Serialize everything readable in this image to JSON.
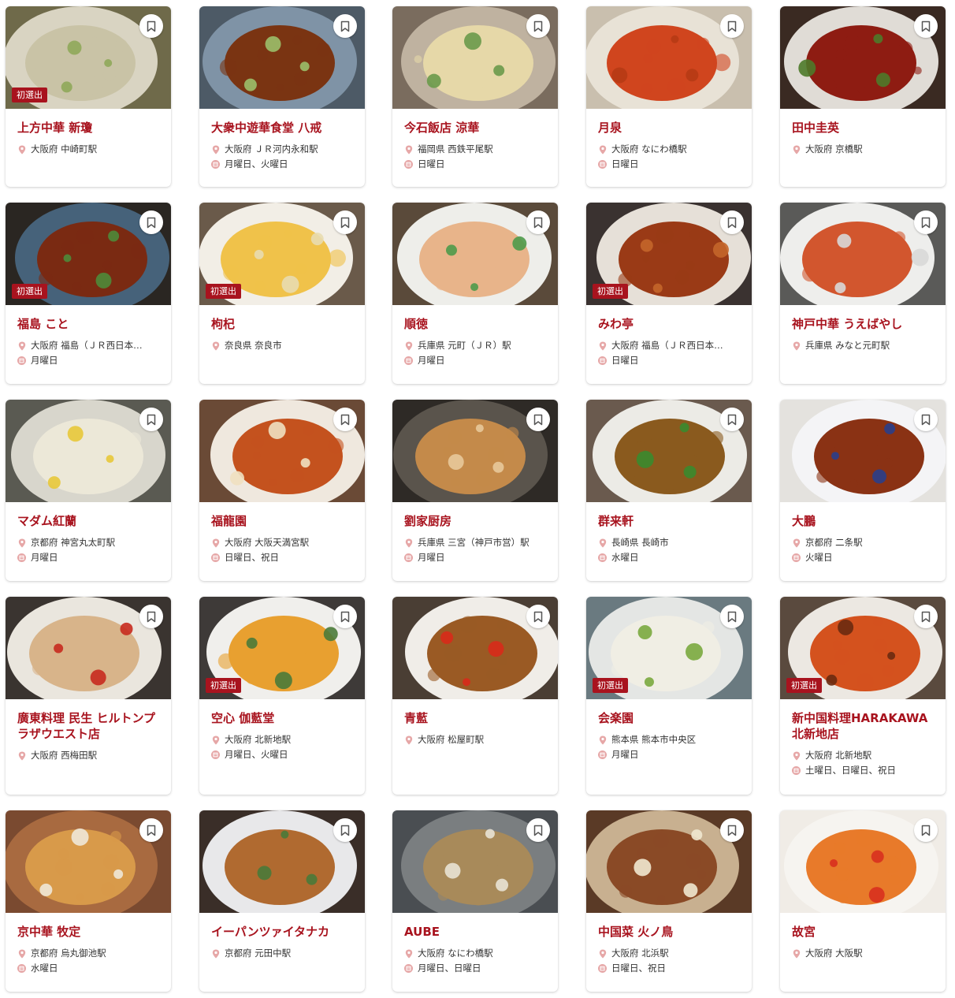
{
  "colors": {
    "accent": "#a8131e",
    "badge_bg": "#a8131e",
    "closed_icon": "#e6a7a7"
  },
  "icons": {
    "location": "map-pin-icon",
    "closed": "closed-day-icon",
    "bookmark": "bookmark-icon"
  },
  "restaurants": [
    {
      "name": "上方中華 新瓊",
      "location": "大阪府 中崎町駅",
      "closed": "",
      "badge": "初選出",
      "photo": {
        "bg": "#6f6a4a",
        "plate": "#d9d4c2",
        "food": "#c9c3a6",
        "accent": "#8fa85a"
      }
    },
    {
      "name": "大衆中遊華食堂 八戒",
      "location": "大阪府 ＪＲ河内永和駅",
      "closed": "月曜日、火曜日",
      "badge": "",
      "photo": {
        "bg": "#4d5a66",
        "plate": "#7f93a6",
        "food": "#7a3412",
        "accent": "#9bbf6a"
      }
    },
    {
      "name": "今石飯店 涼華",
      "location": "福岡県 西鉄平尾駅",
      "closed": "日曜日",
      "badge": "",
      "photo": {
        "bg": "#7a6c5e",
        "plate": "#bfb2a0",
        "food": "#e6d8a8",
        "accent": "#6a9a4a"
      }
    },
    {
      "name": "月泉",
      "location": "大阪府 なにわ橋駅",
      "closed": "日曜日",
      "badge": "",
      "photo": {
        "bg": "#c9bfae",
        "plate": "#e8e2d6",
        "food": "#d0451e",
        "accent": "#b63a14"
      }
    },
    {
      "name": "田中圭英",
      "location": "大阪府 京橋駅",
      "closed": "",
      "badge": "",
      "photo": {
        "bg": "#3a2a22",
        "plate": "#e0dcd6",
        "food": "#8e1c12",
        "accent": "#4e7a2a"
      }
    },
    {
      "name": "福島 こと",
      "location": "大阪府 福島（ＪＲ西日本…",
      "closed": "月曜日",
      "badge": "初選出",
      "photo": {
        "bg": "#2a2622",
        "plate": "#46627a",
        "food": "#7a2a12",
        "accent": "#4e8a3a"
      }
    },
    {
      "name": "枸杞",
      "location": "奈良県 奈良市",
      "closed": "",
      "badge": "初選出",
      "photo": {
        "bg": "#6a5a4a",
        "plate": "#f2eee6",
        "food": "#f0c24a",
        "accent": "#e8dcb0"
      }
    },
    {
      "name": "順徳",
      "location": "兵庫県 元町（ＪＲ）駅",
      "closed": "月曜日",
      "badge": "",
      "photo": {
        "bg": "#5a4a3a",
        "plate": "#eeeeea",
        "food": "#e8b48a",
        "accent": "#4e9a4a"
      }
    },
    {
      "name": "みわ亭",
      "location": "大阪府 福島（ＪＲ西日本…",
      "closed": "日曜日",
      "badge": "初選出",
      "photo": {
        "bg": "#3a3230",
        "plate": "#e6e0d8",
        "food": "#9a3a16",
        "accent": "#c4662a"
      }
    },
    {
      "name": "神戸中華 うえばやし",
      "location": "兵庫県 みなと元町駅",
      "closed": "",
      "badge": "",
      "photo": {
        "bg": "#5a5a58",
        "plate": "#eeeeec",
        "food": "#d2562e",
        "accent": "#d8d8d8"
      }
    },
    {
      "name": "マダム紅蘭",
      "location": "京都府 神宮丸太町駅",
      "closed": "月曜日",
      "badge": "",
      "photo": {
        "bg": "#5a5a52",
        "plate": "#d8d6cc",
        "food": "#ece8d8",
        "accent": "#e8c83a"
      }
    },
    {
      "name": "福龍園",
      "location": "大阪府 大阪天満宮駅",
      "closed": "日曜日、祝日",
      "badge": "",
      "photo": {
        "bg": "#6a4a36",
        "plate": "#efe8de",
        "food": "#c4521e",
        "accent": "#f0e0c0"
      }
    },
    {
      "name": "劉家厨房",
      "location": "兵庫県 三宮（神戸市営）駅",
      "closed": "月曜日",
      "badge": "",
      "photo": {
        "bg": "#2e2a26",
        "plate": "#5a544c",
        "food": "#c48a4a",
        "accent": "#e8c89a"
      }
    },
    {
      "name": "群来軒",
      "location": "長崎県 長崎市",
      "closed": "水曜日",
      "badge": "",
      "photo": {
        "bg": "#6a5a4e",
        "plate": "#ecebe6",
        "food": "#8a5a1e",
        "accent": "#3a8a2e"
      }
    },
    {
      "name": "大鵬",
      "location": "京都府 二条駅",
      "closed": "火曜日",
      "badge": "",
      "photo": {
        "bg": "#e4e2de",
        "plate": "#f4f4f6",
        "food": "#8a3214",
        "accent": "#2a3e8a"
      }
    },
    {
      "name": "廣東料理 民生 ヒルトンプラザウエスト店",
      "location": "大阪府 西梅田駅",
      "closed": "",
      "badge": "",
      "photo": {
        "bg": "#3a3430",
        "plate": "#eae6de",
        "food": "#d8b48a",
        "accent": "#c82a1e"
      }
    },
    {
      "name": "空心 伽藍堂",
      "location": "大阪府 北新地駅",
      "closed": "月曜日、火曜日",
      "badge": "初選出",
      "photo": {
        "bg": "#3e3a38",
        "plate": "#f0efec",
        "food": "#e8a030",
        "accent": "#4a7a3a"
      }
    },
    {
      "name": "青藍",
      "location": "大阪府 松屋町駅",
      "closed": "",
      "badge": "",
      "photo": {
        "bg": "#4a3e34",
        "plate": "#f0ede8",
        "food": "#9a5a24",
        "accent": "#d82a1a"
      }
    },
    {
      "name": "会楽園",
      "location": "熊本県 熊本市中央区",
      "closed": "月曜日",
      "badge": "初選出",
      "photo": {
        "bg": "#6a7a80",
        "plate": "#e4e6e4",
        "food": "#f0eee4",
        "accent": "#7aa83e"
      }
    },
    {
      "name": "新中国料理HARAKAWA 北新地店",
      "location": "大阪府 北新地駅",
      "closed": "土曜日、日曜日、祝日",
      "badge": "初選出",
      "photo": {
        "bg": "#5a4a3e",
        "plate": "#ece8e2",
        "food": "#d4521e",
        "accent": "#6a2a10"
      }
    },
    {
      "name": "京中華 牧定",
      "location": "京都府 烏丸御池駅",
      "closed": "水曜日",
      "badge": "",
      "photo": {
        "bg": "#7a4a30",
        "plate": "#a86a40",
        "food": "#d89a4a",
        "accent": "#f0e8d8"
      }
    },
    {
      "name": "イーパンツァイタナカ",
      "location": "京都府 元田中駅",
      "closed": "",
      "badge": "",
      "photo": {
        "bg": "#3a2e28",
        "plate": "#e8e8ea",
        "food": "#b06a30",
        "accent": "#4a7a3a"
      }
    },
    {
      "name": "AUBE",
      "location": "大阪府 なにわ橋駅",
      "closed": "月曜日、日曜日",
      "badge": "",
      "photo": {
        "bg": "#4a4e52",
        "plate": "#7a7e80",
        "food": "#a88a5a",
        "accent": "#e8e2d4"
      }
    },
    {
      "name": "中国菜 火ノ鳥",
      "location": "大阪府 北浜駅",
      "closed": "日曜日、祝日",
      "badge": "",
      "photo": {
        "bg": "#5a3a26",
        "plate": "#c8b090",
        "food": "#8a4a26",
        "accent": "#f0e8d0"
      }
    },
    {
      "name": "故宮",
      "location": "大阪府 大阪駅",
      "closed": "",
      "badge": "",
      "photo": {
        "bg": "#f0ece6",
        "plate": "#f6f4f0",
        "food": "#e87a2a",
        "accent": "#d8301e"
      }
    }
  ]
}
